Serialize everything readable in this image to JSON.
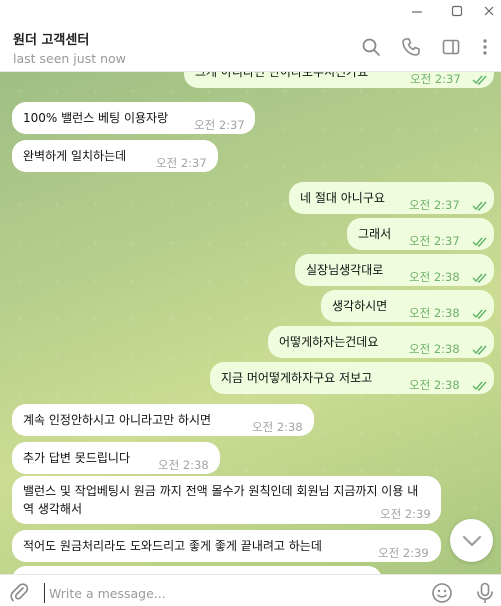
{
  "window": {
    "minimize_label": "—",
    "maximize_label": "□",
    "close_label": "✕"
  },
  "header": {
    "title": "원더 고객센터",
    "status": "last seen just now",
    "icons": [
      "search-icon",
      "phone-icon",
      "sidebar-icon",
      "more-icon"
    ]
  },
  "messages": [
    {
      "dir": "out",
      "text": "그게 아니라면 반이타보우시신가요",
      "time": "오전 2:37",
      "read": true
    },
    {
      "dir": "in",
      "text": "100% 밸런스 베팅 이용자랑",
      "time": "오전 2:37"
    },
    {
      "dir": "in",
      "text": "완벽하게 일치하는데",
      "time": "오전 2:37"
    },
    {
      "dir": "out",
      "text": "네 절대 아니구요",
      "time": "오전 2:37",
      "read": true
    },
    {
      "dir": "out",
      "text": "그래서",
      "time": "오전 2:37",
      "read": true
    },
    {
      "dir": "out",
      "text": "실장님생각대로",
      "time": "오전 2:38",
      "read": true
    },
    {
      "dir": "out",
      "text": "생각하시면",
      "time": "오전 2:38",
      "read": true
    },
    {
      "dir": "out",
      "text": "어떻게하자는건데요",
      "time": "오전 2:38",
      "read": true
    },
    {
      "dir": "out",
      "text": "지금 머어떻게하자구요 저보고",
      "time": "오전 2:38",
      "read": true
    },
    {
      "dir": "in",
      "text": "계속 인정안하시고 아니라고만 하시면",
      "time": "오전 2:38"
    },
    {
      "dir": "in",
      "text": "추가 답변 못드립니다",
      "time": "오전 2:38"
    },
    {
      "dir": "in",
      "text": "밸런스 및 작업베팅시 원금 까지 전액 몰수가 원칙인데 회원님 지금까지 이용 내역 생각해서",
      "time": "오전 2:39"
    },
    {
      "dir": "in",
      "text": "적어도 원금처리라도 도와드리고 좋게 좋게 끝내려고 하는데",
      "time": "오전 2:39"
    }
  ],
  "composer": {
    "placeholder": "Write a message...",
    "value": ""
  },
  "colors": {
    "accent": "#5eb56a",
    "outgoing_bubble": "#effdde",
    "incoming_bubble": "#ffffff",
    "chat_background": "#b7cf8c"
  }
}
